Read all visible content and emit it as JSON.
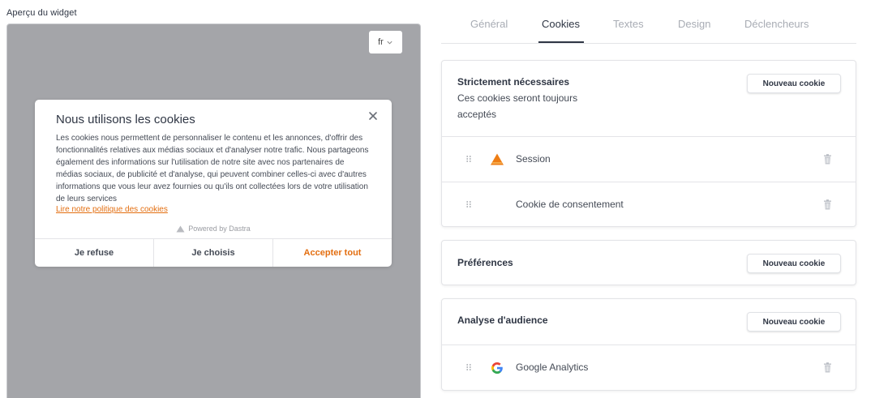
{
  "preview": {
    "label": "Aperçu du widget",
    "language": "fr",
    "modal": {
      "title": "Nous utilisons les cookies",
      "body": "Les cookies nous permettent de personnaliser le contenu et les annonces, d'offrir des fonctionnalités relatives aux médias sociaux et d'analyser notre trafic. Nous partageons également des informations sur l'utilisation de notre site avec nos partenaires de médias sociaux, de publicité et d'analyse, qui peuvent combiner celles-ci avec d'autres informations que vous leur avez fournies ou qu'ils ont collectées lors de votre utilisation de leurs services",
      "link": "Lire notre politique des cookies",
      "powered_by": "Powered by Dastra",
      "buttons": {
        "refuse": "Je refuse",
        "choose": "Je choisis",
        "accept_all": "Accepter tout"
      }
    }
  },
  "tabs": [
    "Général",
    "Cookies",
    "Textes",
    "Design",
    "Déclencheurs"
  ],
  "active_tab": "Cookies",
  "sections": {
    "necessary": {
      "title": "Strictement nécessaires",
      "description": "Ces cookies seront toujours acceptés",
      "button": "Nouveau cookie",
      "cookies": [
        {
          "label": "Session",
          "icon": "dastra-icon"
        },
        {
          "label": "Cookie de consentement",
          "icon": ""
        }
      ]
    },
    "preferences": {
      "title": "Préférences",
      "button": "Nouveau cookie"
    },
    "audience": {
      "title": "Analyse d'audience",
      "button": "Nouveau cookie",
      "cookies": [
        {
          "label": "Google Analytics",
          "icon": "google-icon"
        }
      ]
    }
  },
  "colors": {
    "accent": "#e36e10",
    "text": "#2f3644",
    "muted_tab": "#a8acb4",
    "preview_bg": "#a4a5a9"
  }
}
